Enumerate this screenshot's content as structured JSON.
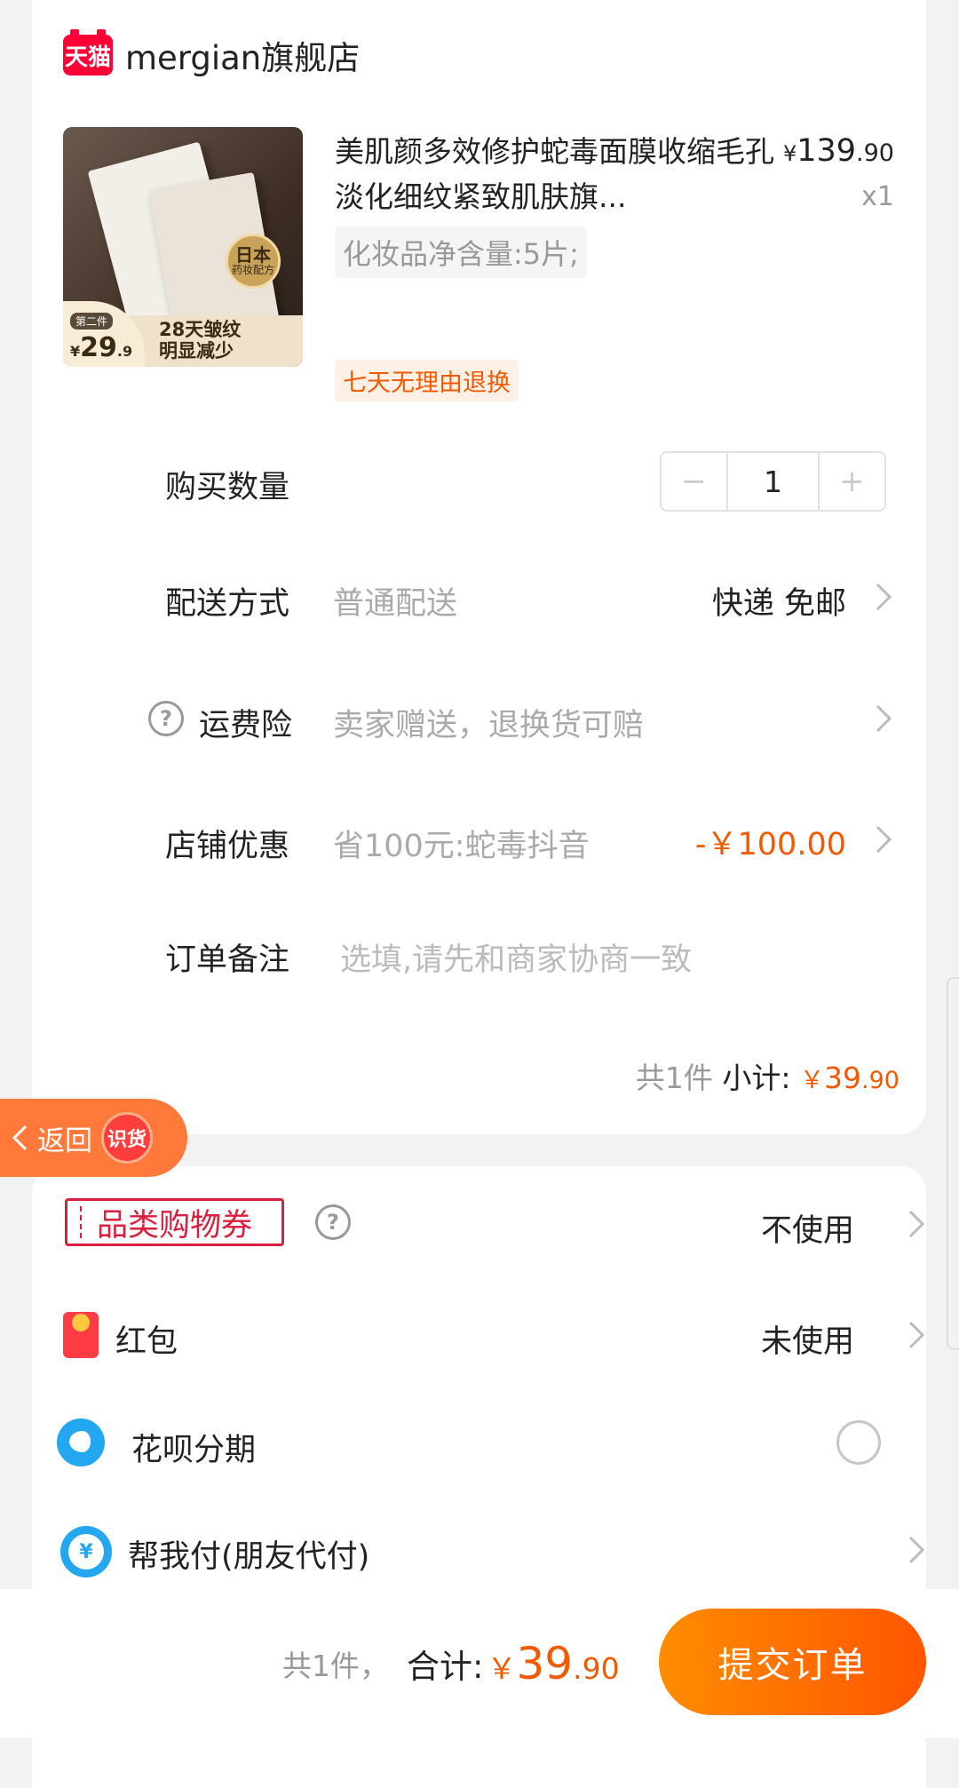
{
  "shop": {
    "badge": "天猫",
    "name": "mergian旗舰店"
  },
  "product": {
    "title": "美肌颜多效修护蛇毒面膜收缩毛孔淡化细纹紧致肌肤旗...",
    "price_yen": "¥",
    "price_int": "139",
    "price_cents": ".90",
    "quantity": "x1",
    "sku": "化妆品净含量:5片;",
    "return_tag": "七天无理由退换",
    "image": {
      "seal_big": "日本",
      "seal_small": "药妆配方",
      "tag_second": "第二件",
      "promo_price_yen": "¥",
      "promo_price_int": "29",
      "promo_price_cents": ".9",
      "band_line1": "28天皱纹",
      "band_line2": "明显减少"
    }
  },
  "quantity_row": {
    "label": "购买数量",
    "minus": "−",
    "value": "1",
    "plus": "+"
  },
  "delivery_row": {
    "label": "配送方式",
    "sub": "普通配送",
    "right": "快递 免邮"
  },
  "insurance_row": {
    "help_icon": "?",
    "label": "运费险",
    "sub": "卖家赠送，退换货可赔"
  },
  "shop_discount_row": {
    "label": "店铺优惠",
    "sub": "省100元:蛇毒抖音",
    "value": "-￥100.00"
  },
  "note_row": {
    "label": "订单备注",
    "placeholder": "选填,请先和商家协商一致"
  },
  "subtotal": {
    "count": "共1件",
    "label": "小计:",
    "yen": "￥",
    "int": "39",
    "cents": ".90"
  },
  "back_pill": {
    "label": "返回",
    "badge": "识货"
  },
  "coupon_row": {
    "label": "品类购物券",
    "help_icon": "?",
    "value": "不使用"
  },
  "redpacket_row": {
    "label": "红包",
    "value": "未使用"
  },
  "huabei_row": {
    "label": "花呗分期"
  },
  "friend_pay_row": {
    "icon_glyph": "¥",
    "label": "帮我付(朋友代付)"
  },
  "footer": {
    "count": "共1件，",
    "total_label": "合计:",
    "yen": "￥",
    "int": "39",
    "cents": ".90",
    "submit": "提交订单"
  },
  "colors": {
    "accent": "#f25a00",
    "tmall_red": "#ff0036",
    "coupon_red": "#d91f3d",
    "alipay_blue": "#22a7f0"
  }
}
